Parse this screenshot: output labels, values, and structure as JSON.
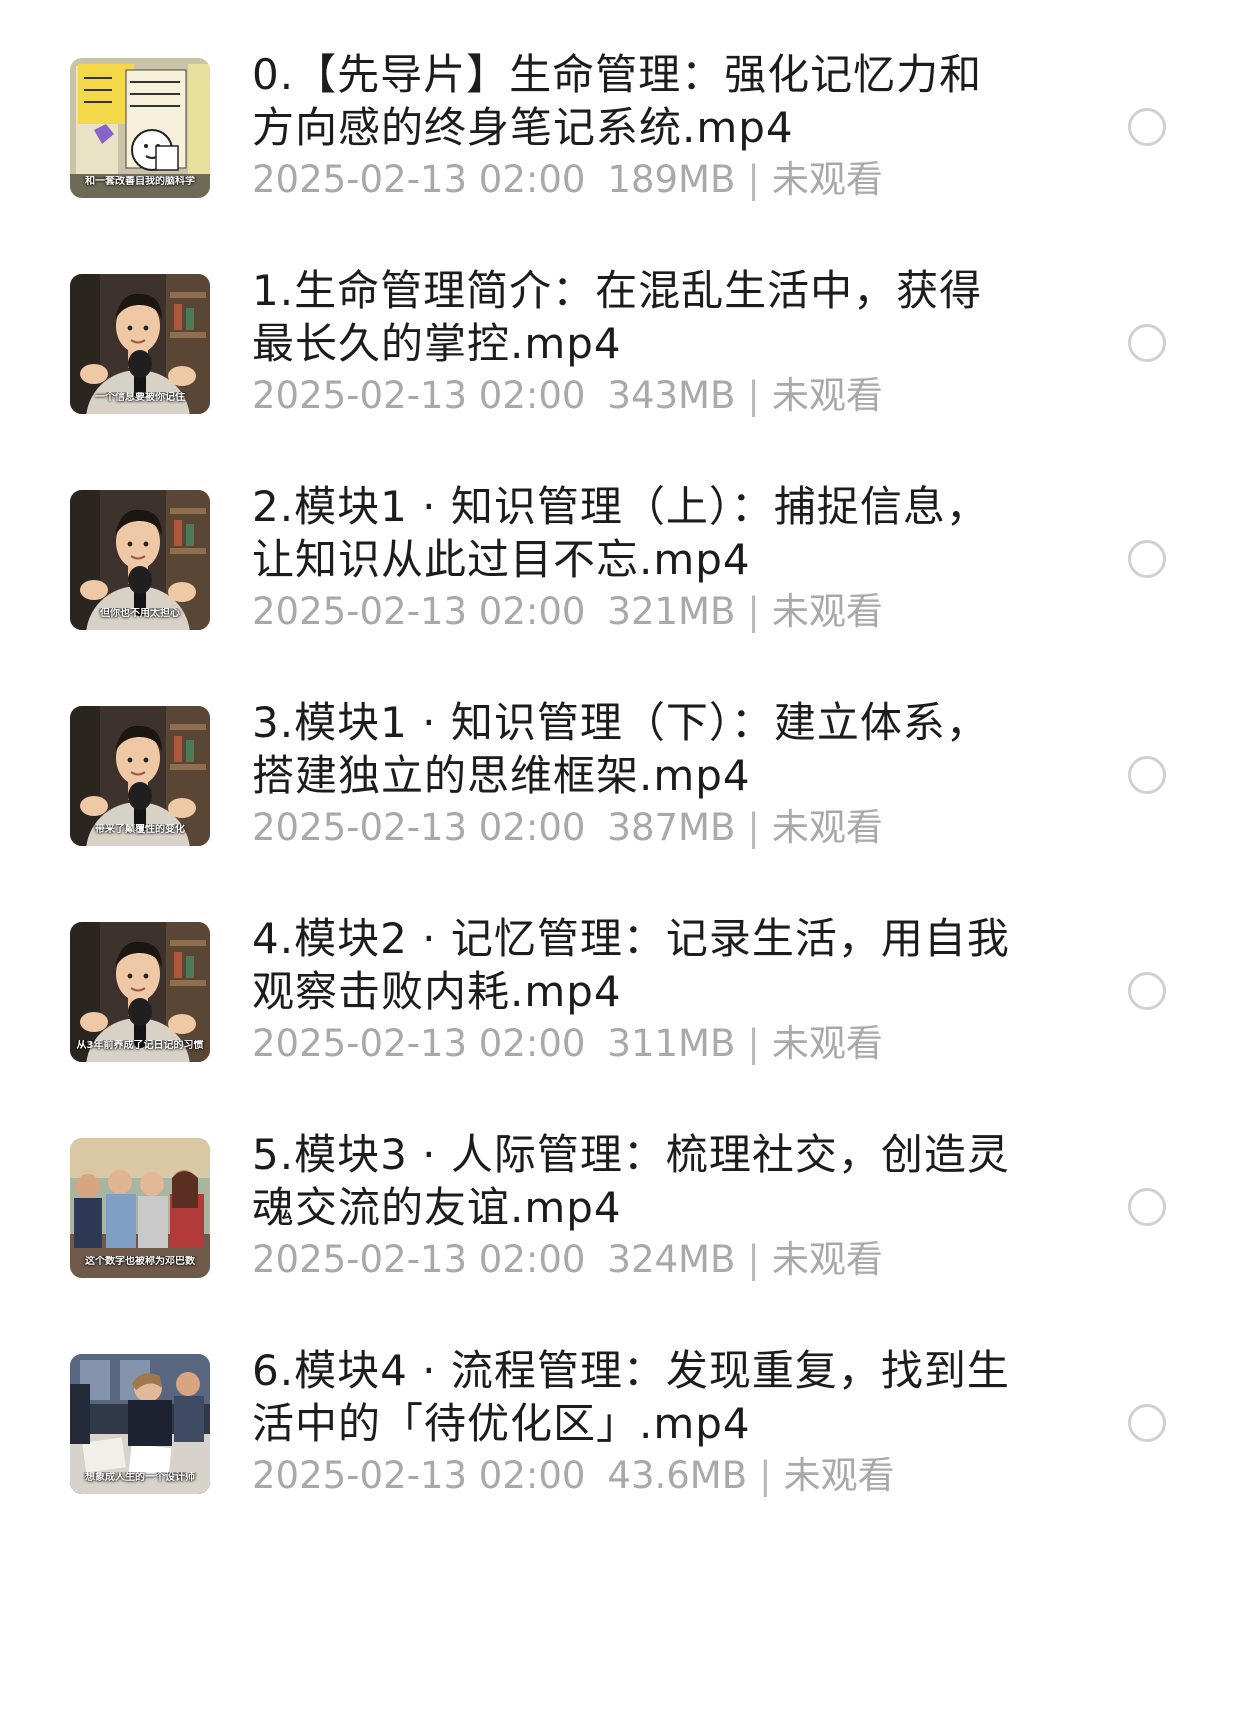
{
  "files": [
    {
      "title": "0.【先导片】生命管理：强化记忆力和方向感的终身笔记系统.mp4",
      "date": "2025-02-13 02:00",
      "size": "189MB",
      "separator": "|",
      "status": "未观看",
      "thumbnail_caption": "和一套改善自我的脑科学",
      "thumbnail_type": "illustration"
    },
    {
      "title": "1.生命管理简介：在混乱生活中，获得最长久的掌控.mp4",
      "date": "2025-02-13 02:00",
      "size": "343MB",
      "separator": "|",
      "status": "未观看",
      "thumbnail_caption": "一个信息要被你记住",
      "thumbnail_type": "speaker"
    },
    {
      "title": "2.模块1 · 知识管理（上）：捕捉信息，让知识从此过目不忘.mp4",
      "date": "2025-02-13 02:00",
      "size": "321MB",
      "separator": "|",
      "status": "未观看",
      "thumbnail_caption": "但你也不用太担心",
      "thumbnail_type": "speaker"
    },
    {
      "title": "3.模块1 · 知识管理（下）：建立体系，搭建独立的思维框架.mp4",
      "date": "2025-02-13 02:00",
      "size": "387MB",
      "separator": "|",
      "status": "未观看",
      "thumbnail_caption": "带来了颠覆性的变化",
      "thumbnail_type": "speaker"
    },
    {
      "title": "4.模块2 · 记忆管理：记录生活，用自我观察击败内耗.mp4",
      "date": "2025-02-13 02:00",
      "size": "311MB",
      "separator": "|",
      "status": "未观看",
      "thumbnail_caption": "从3年前养成了记日记的习惯",
      "thumbnail_type": "speaker"
    },
    {
      "title": "5.模块3 · 人际管理：梳理社交，创造灵魂交流的友谊.mp4",
      "date": "2025-02-13 02:00",
      "size": "324MB",
      "separator": "|",
      "status": "未观看",
      "thumbnail_caption": "这个数字也被称为邓巴数",
      "thumbnail_type": "group"
    },
    {
      "title": "6.模块4 · 流程管理：发现重复，找到生活中的「待优化区」.mp4",
      "date": "2025-02-13 02:00",
      "size": "43.6MB",
      "separator": "|",
      "status": "未观看",
      "thumbnail_caption": "想象成人生的一个设计师",
      "thumbnail_type": "workshop"
    }
  ],
  "colors": {
    "title": "#1c1c1c",
    "meta": "#a9a9a9",
    "radio_border": "#d0d0d0",
    "background": "#ffffff"
  }
}
